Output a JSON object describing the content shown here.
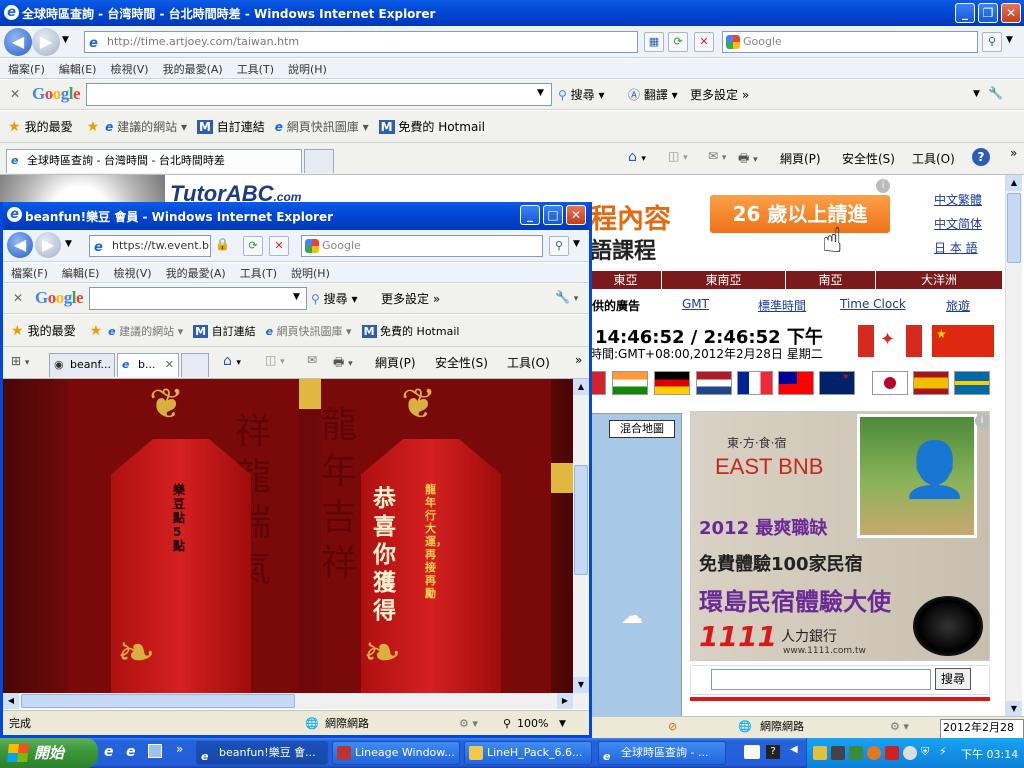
{
  "main_window": {
    "title": "全球時區查詢 - 台湾時間 - 台北時間時差 - Windows Internet Explorer",
    "address": "http://time.artjoey.com/taiwan.htm",
    "search_placeholder": "Google",
    "menu": [
      "檔案(F)",
      "編輯(E)",
      "檢視(V)",
      "我的最愛(A)",
      "工具(T)",
      "說明(H)"
    ],
    "google_bar": {
      "logo": "Google",
      "search_btn": "搜尋",
      "translate_btn": "翻譯",
      "more_settings": "更多設定"
    },
    "favorites": {
      "label": "我的最愛",
      "links": [
        "建議的網站",
        "自訂連結",
        "網頁快訊圖庫",
        "免費的 Hotmail"
      ]
    },
    "tab_title": "全球時區查詢 - 台灣時間 - 台北時間時差",
    "command_bar": {
      "page": "網頁(P)",
      "security": "安全性(S)",
      "tools": "工具(O)"
    },
    "status": {
      "zone": "網際網路",
      "date": "2012年2月28日"
    }
  },
  "page": {
    "tutor_logo": "TutorABC",
    "tutor_suffix": ".com",
    "ad_text_1": "程內容",
    "ad_text_2": "語課程",
    "ad_button": "26 歲以上請進",
    "lang_links": [
      "中文繁體",
      "中文简体",
      "日 本 語"
    ],
    "regions": [
      "東亞",
      "東南亞",
      "南亞",
      "大洋洲"
    ],
    "ad_provided": "供的廣告",
    "nav_links": [
      "GMT",
      "標準時間",
      "Time Clock",
      "旅遊"
    ],
    "clock": "14:46:52 / 2:46:52 下午",
    "time_info": "時間:GMT+08:00,2012年2月28日 星期二",
    "map_button": "混合地圖",
    "ad2": {
      "small_title": "東·方·食·宿",
      "brand": "EAST BNB",
      "line1": "2012 最爽職缺",
      "line2": "免費體驗100家民宿",
      "line3": "環島民宿體驗大使",
      "company_num": "1111",
      "company_name": "人力銀行",
      "company_url": "www.1111.com.tw"
    },
    "search_button": "搜尋"
  },
  "popup_window": {
    "title": "beanfun!樂豆 會員 - Windows Internet Explorer",
    "address": "https://tw.event.b",
    "search_placeholder": "Google",
    "menu": [
      "檔案(F)",
      "編輯(E)",
      "檢視(V)",
      "我的最愛(A)",
      "工具(T)",
      "說明(H)"
    ],
    "google_bar": {
      "logo": "Google",
      "search_btn": "搜尋",
      "more_settings": "更多設定"
    },
    "favorites": {
      "label": "我的最愛",
      "links": [
        "建議的網站",
        "自訂連結",
        "網頁快訊圖庫",
        "免費的 Hotmail"
      ]
    },
    "tabs": [
      "beanf...",
      "b..."
    ],
    "command_bar": {
      "page": "網頁(P)",
      "security": "安全性(S)",
      "tools": "工具(O)"
    },
    "content": {
      "tag1_text": "樂豆點5點",
      "tag2_big": "恭喜你獲得",
      "tag2_small": "龍年行大運，再接再勵",
      "bg_chars_1": "祥龍瑞氣",
      "bg_chars_2": "龍年吉祥"
    },
    "status": {
      "done": "完成",
      "zone": "網際網路",
      "zoom": "100%"
    }
  },
  "taskbar": {
    "start": "開始",
    "tasks": [
      "beanfun!樂豆 會...",
      "Lineage Window...",
      "LineH_Pack_6.6...",
      "全球時區查詢 - ..."
    ],
    "clock": "下午 03:14"
  },
  "colors": {
    "xp_blue": "#0348d8",
    "region_bar": "#7a1a1a",
    "ad_orange": "#f07b1a",
    "ad_purple": "#6a2a96",
    "red_tag": "#c01818"
  }
}
